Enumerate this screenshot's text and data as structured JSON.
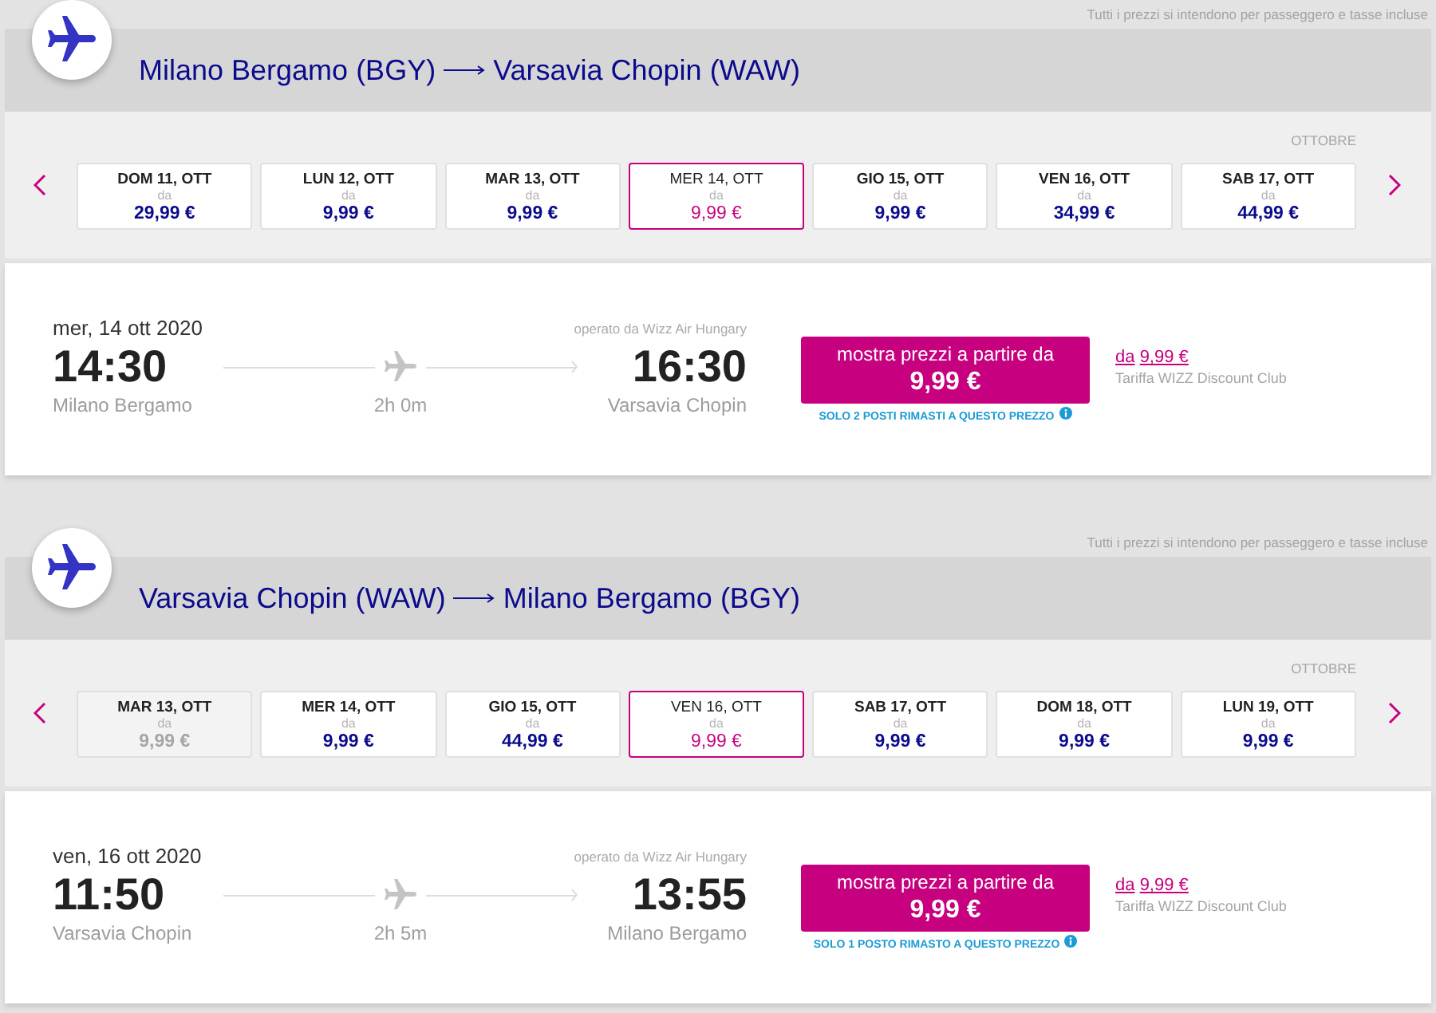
{
  "sections": [
    {
      "note": "Tutti i prezzi si intendono per passeggero e tasse incluse",
      "route": {
        "origin": "Milano Bergamo (BGY)",
        "destination": "Varsavia Chopin (WAW)"
      },
      "month": "OTTOBRE",
      "dates": [
        {
          "day": "DOM 11, OTT",
          "from_label": "da",
          "price": "29,99 €",
          "selected": false,
          "disabled": false
        },
        {
          "day": "LUN 12, OTT",
          "from_label": "da",
          "price": "9,99 €",
          "selected": false,
          "disabled": false
        },
        {
          "day": "MAR 13, OTT",
          "from_label": "da",
          "price": "9,99 €",
          "selected": false,
          "disabled": false
        },
        {
          "day": "MER 14, OTT",
          "from_label": "da",
          "price": "9,99 €",
          "selected": true,
          "disabled": false
        },
        {
          "day": "GIO 15, OTT",
          "from_label": "da",
          "price": "9,99 €",
          "selected": false,
          "disabled": false
        },
        {
          "day": "VEN 16, OTT",
          "from_label": "da",
          "price": "34,99 €",
          "selected": false,
          "disabled": false
        },
        {
          "day": "SAB 17, OTT",
          "from_label": "da",
          "price": "44,99 €",
          "selected": false,
          "disabled": false
        }
      ],
      "flight": {
        "date": "mer, 14 ott 2020",
        "departure_time": "14:30",
        "departure_airport": "Milano Bergamo",
        "duration": "2h 0m",
        "operator": "operato da Wizz Air Hungary",
        "arrival_time": "16:30",
        "arrival_airport": "Varsavia Chopin",
        "price_button": {
          "label": "mostra prezzi a partire da",
          "price": "9,99 €"
        },
        "availability": "SOLO 2 POSTI RIMASTI A QUESTO PREZZO",
        "club_price": {
          "prefix": "da",
          "price": "9,99 €"
        },
        "club_label": "Tariffa WIZZ Discount Club"
      }
    },
    {
      "note": "Tutti i prezzi si intendono per passeggero e tasse incluse",
      "route": {
        "origin": "Varsavia Chopin (WAW)",
        "destination": "Milano Bergamo (BGY)"
      },
      "month": "OTTOBRE",
      "dates": [
        {
          "day": "MAR 13, OTT",
          "from_label": "da",
          "price": "9,99 €",
          "selected": false,
          "disabled": true
        },
        {
          "day": "MER 14, OTT",
          "from_label": "da",
          "price": "9,99 €",
          "selected": false,
          "disabled": false
        },
        {
          "day": "GIO 15, OTT",
          "from_label": "da",
          "price": "44,99 €",
          "selected": false,
          "disabled": false
        },
        {
          "day": "VEN 16, OTT",
          "from_label": "da",
          "price": "9,99 €",
          "selected": true,
          "disabled": false
        },
        {
          "day": "SAB 17, OTT",
          "from_label": "da",
          "price": "9,99 €",
          "selected": false,
          "disabled": false
        },
        {
          "day": "DOM 18, OTT",
          "from_label": "da",
          "price": "9,99 €",
          "selected": false,
          "disabled": false
        },
        {
          "day": "LUN 19, OTT",
          "from_label": "da",
          "price": "9,99 €",
          "selected": false,
          "disabled": false
        }
      ],
      "flight": {
        "date": "ven, 16 ott 2020",
        "departure_time": "11:50",
        "departure_airport": "Varsavia Chopin",
        "duration": "2h 5m",
        "operator": "operato da Wizz Air Hungary",
        "arrival_time": "13:55",
        "arrival_airport": "Milano Bergamo",
        "price_button": {
          "label": "mostra prezzi a partire da",
          "price": "9,99 €"
        },
        "availability": "SOLO 1 POSTO RIMASTO A QUESTO PREZZO",
        "club_price": {
          "prefix": "da",
          "price": "9,99 €"
        },
        "club_label": "Tariffa WIZZ Discount Club"
      }
    }
  ]
}
